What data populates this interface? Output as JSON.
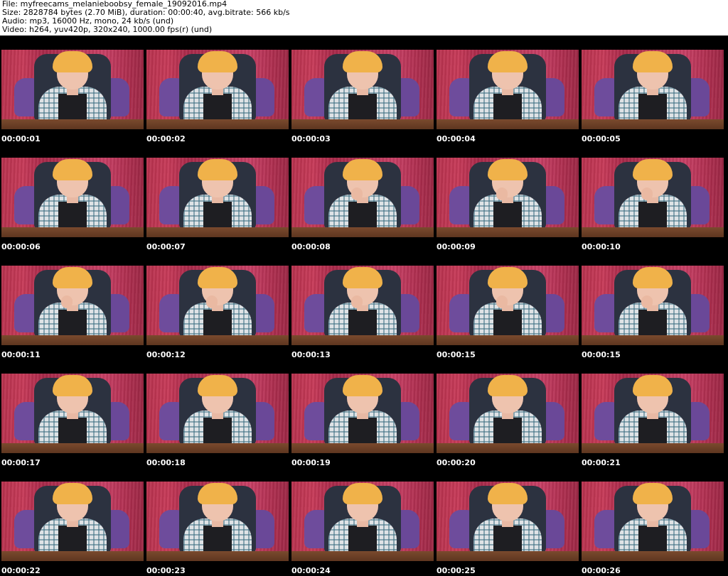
{
  "header": {
    "file_line": "File: myfreecams_melanieboobsy_female_19092016.mp4",
    "size_line": "Size: 2828784 bytes (2.70 MiB), duration: 00:00:40, avg.bitrate: 566 kb/s",
    "audio_line": "Audio: mp3, 16000 Hz, mono, 24 kb/s (und)",
    "video_line": "Video: h264, yuv420p, 320x240, 1000.00 fps(r) (und)"
  },
  "grid": {
    "columns": 5,
    "rows": 5
  },
  "colors": {
    "background": "#ffffff",
    "sheet": "#000000",
    "header_text": "#000000",
    "timestamp_text": "#ffffff",
    "wall": "#b8324e",
    "chair": "#6e4c9c",
    "hair": "#f0b24a"
  },
  "thumbnails": [
    {
      "timestamp": "00:00:01",
      "hand_at_mouth": false
    },
    {
      "timestamp": "00:00:02",
      "hand_at_mouth": false
    },
    {
      "timestamp": "00:00:03",
      "hand_at_mouth": false
    },
    {
      "timestamp": "00:00:04",
      "hand_at_mouth": false
    },
    {
      "timestamp": "00:00:05",
      "hand_at_mouth": false
    },
    {
      "timestamp": "00:00:06",
      "hand_at_mouth": false
    },
    {
      "timestamp": "00:00:07",
      "hand_at_mouth": false
    },
    {
      "timestamp": "00:00:08",
      "hand_at_mouth": true
    },
    {
      "timestamp": "00:00:09",
      "hand_at_mouth": true
    },
    {
      "timestamp": "00:00:10",
      "hand_at_mouth": true
    },
    {
      "timestamp": "00:00:11",
      "hand_at_mouth": true
    },
    {
      "timestamp": "00:00:12",
      "hand_at_mouth": true
    },
    {
      "timestamp": "00:00:13",
      "hand_at_mouth": true
    },
    {
      "timestamp": "00:00:15",
      "hand_at_mouth": true
    },
    {
      "timestamp": "00:00:15",
      "hand_at_mouth": true
    },
    {
      "timestamp": "00:00:17",
      "hand_at_mouth": false
    },
    {
      "timestamp": "00:00:18",
      "hand_at_mouth": false
    },
    {
      "timestamp": "00:00:19",
      "hand_at_mouth": false
    },
    {
      "timestamp": "00:00:20",
      "hand_at_mouth": false
    },
    {
      "timestamp": "00:00:21",
      "hand_at_mouth": false
    },
    {
      "timestamp": "00:00:22",
      "hand_at_mouth": false
    },
    {
      "timestamp": "00:00:23",
      "hand_at_mouth": false
    },
    {
      "timestamp": "00:00:24",
      "hand_at_mouth": false
    },
    {
      "timestamp": "00:00:25",
      "hand_at_mouth": false
    },
    {
      "timestamp": "00:00:26",
      "hand_at_mouth": false
    }
  ]
}
